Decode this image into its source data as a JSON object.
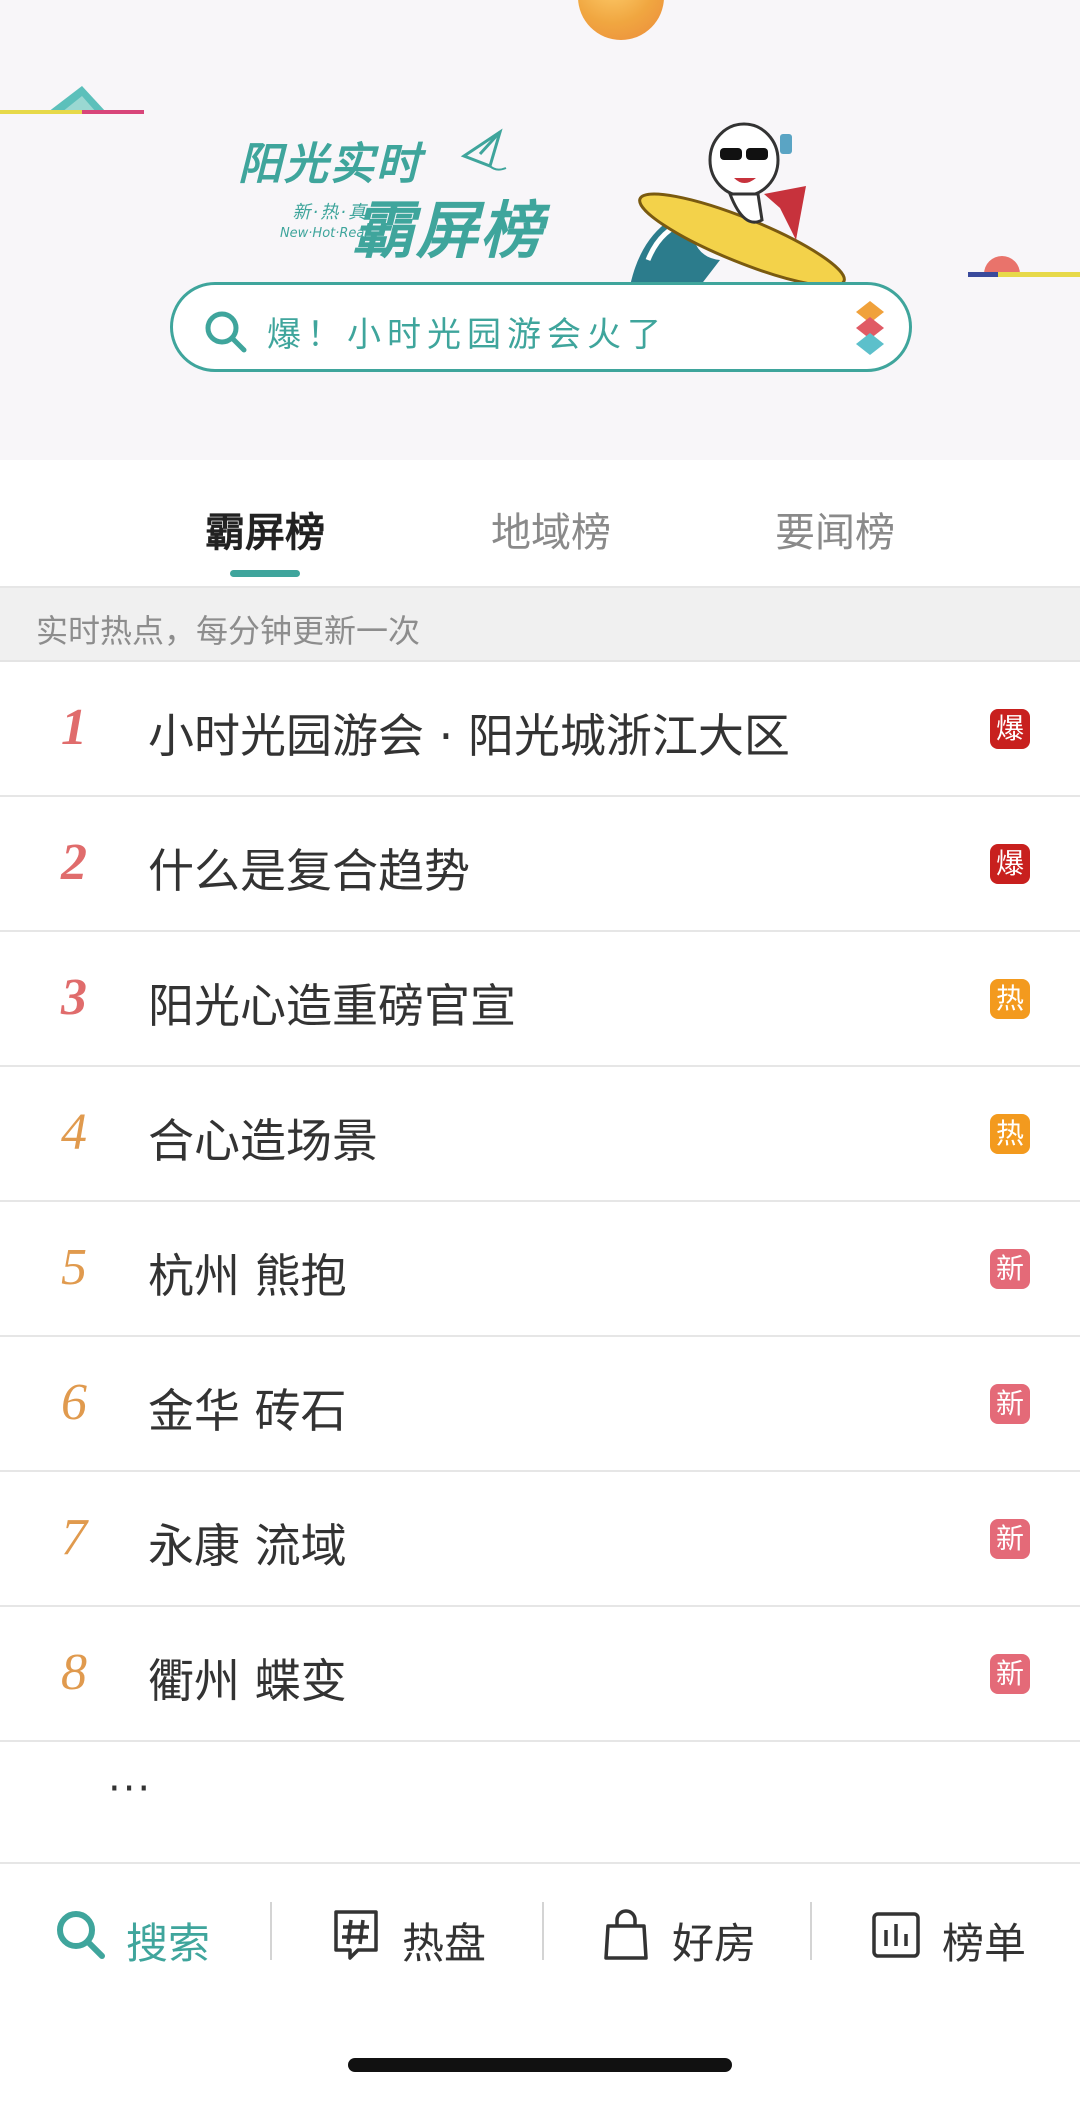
{
  "banner": {
    "logo_line1": "阳光实时",
    "logo_tag_cn": "新·热·真",
    "logo_tag_en": "New·Hot·Real",
    "logo_line2": "霸屏榜",
    "search_placeholder": "爆！小时光园游会火了",
    "accent_color": "#3fa59c"
  },
  "tabs": [
    {
      "label": "霸屏榜",
      "active": true
    },
    {
      "label": "地域榜",
      "active": false
    },
    {
      "label": "要闻榜",
      "active": false
    }
  ],
  "notice": "实时热点，每分钟更新一次",
  "list": [
    {
      "rank": "1",
      "title": "小时光园游会 · 阳光城浙江大区",
      "badge": "爆",
      "badge_color": "#c8201e"
    },
    {
      "rank": "2",
      "title": "什么是复合趋势",
      "badge": "爆",
      "badge_color": "#c8201e"
    },
    {
      "rank": "3",
      "title": "阳光心造重磅官宣",
      "badge": "热",
      "badge_color": "#f39a1e"
    },
    {
      "rank": "4",
      "title": "合心造场景",
      "badge": "热",
      "badge_color": "#f39a1e"
    },
    {
      "rank": "5",
      "title": "杭州 熊抱",
      "badge": "新",
      "badge_color": "#e46a78"
    },
    {
      "rank": "6",
      "title": "金华 砖石",
      "badge": "新",
      "badge_color": "#e46a78"
    },
    {
      "rank": "7",
      "title": "永康 流域",
      "badge": "新",
      "badge_color": "#e46a78"
    },
    {
      "rank": "8",
      "title": "衢州 蝶变",
      "badge": "新",
      "badge_color": "#e46a78"
    }
  ],
  "more_text": "···",
  "bottom_nav": [
    {
      "label": "搜索",
      "icon": "search-icon",
      "active": true
    },
    {
      "label": "热盘",
      "icon": "hashtag-icon",
      "active": false
    },
    {
      "label": "好房",
      "icon": "shopping-bag-icon",
      "active": false
    },
    {
      "label": "榜单",
      "icon": "bar-chart-icon",
      "active": false
    }
  ]
}
